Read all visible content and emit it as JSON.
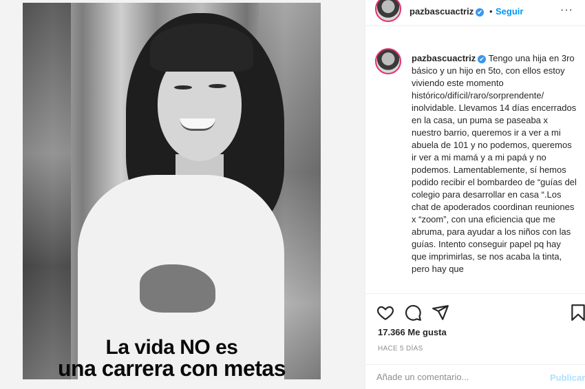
{
  "post": {
    "image_caption_line1": "La vida NO es",
    "image_caption_line2": "una carrera con metas"
  },
  "header": {
    "username": "pazbascuactriz",
    "verified_mark": "✔",
    "separator": "•",
    "follow_label": "Seguir",
    "more_label": "···"
  },
  "caption": {
    "username": "pazbascuactriz",
    "text": "Tengo una hija en 3ro básico y un hijo en 5to, con ellos estoy viviendo este momento histórico/difícil/raro/sorprendente/ inolvidable. Llevamos 14 días encerrados en la casa, un puma se paseaba x nuestro barrio, queremos ir a ver a mi abuela de 101 y no podemos, queremos ir ver a mi mamá y a mi papá y no podemos. Lamentablemente, sí hemos podido recibir el bombardeo de “guías del colegio para desarrollar en casa “.Los chat de apoderados coordinan reuniones x “zoom”, con una eficiencia que me abruma, para ayudar a los niños con las guías. Intento conseguir papel pq hay que imprimirlas, se nos acaba la tinta, pero hay que "
  },
  "actions": {
    "icons": [
      "heart-icon",
      "comment-icon",
      "share-icon",
      "save-icon"
    ],
    "likes": "17.366 Me gusta",
    "timestamp": "HACE 5 DÍAS"
  },
  "comment_box": {
    "placeholder": "Añade un comentario...",
    "publish_label": "Publicar"
  },
  "colors": {
    "link_blue": "#0095f6",
    "verified_blue": "#3897f0",
    "publish_disabled": "#b2dffc",
    "avatar_ring": "#e1306c"
  }
}
